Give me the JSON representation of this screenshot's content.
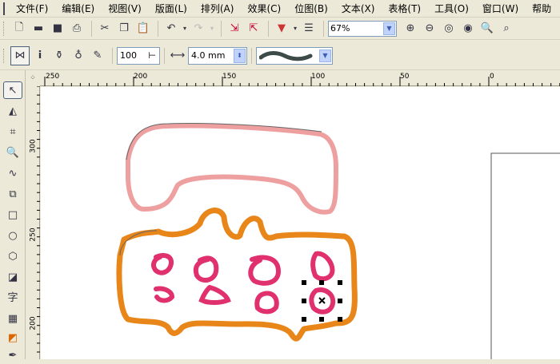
{
  "menu": [
    "文件(F)",
    "编辑(E)",
    "视图(V)",
    "版面(L)",
    "排列(A)",
    "效果(C)",
    "位图(B)",
    "文本(X)",
    "表格(T)",
    "工具(O)",
    "窗口(W)",
    "帮助"
  ],
  "toolbar": {
    "zoom_value": "67%"
  },
  "property_bar": {
    "smoothness": "100",
    "width_value": "4.0 mm"
  },
  "ruler": {
    "h_labels": [
      "250",
      "200",
      "150",
      "100",
      "50",
      "0"
    ],
    "v_labels": [
      "300",
      "250",
      "200"
    ]
  },
  "toolbox": {
    "text_tool": "字"
  },
  "colors": {
    "receiver": "#eea0a0",
    "base": "#e8861a",
    "buttons": "#e0306e"
  }
}
